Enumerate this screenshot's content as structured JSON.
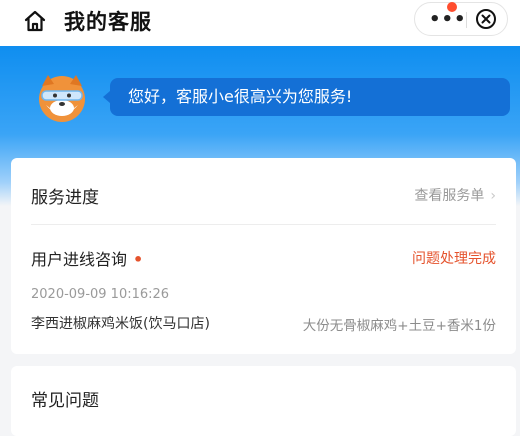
{
  "nav": {
    "title": "我的客服",
    "more_glyph": "•••"
  },
  "banner": {
    "greeting": "您好，客服小e很高兴为您服务!"
  },
  "service_progress": {
    "title": "服务进度",
    "view_link": "查看服务单",
    "chevron": "›",
    "consult_label": "用户进线咨询",
    "dot": "•",
    "status": "问题处理完成",
    "timestamp": "2020-09-09 10:16:26",
    "shop": "李西进椒麻鸡米饭(饮马口店)",
    "order_items": "大份无骨椒麻鸡+土豆+香米1份"
  },
  "faq": {
    "title": "常见问题"
  },
  "colors": {
    "brand_blue": "#0f8ef0",
    "bubble_blue": "#1470d6",
    "status_red": "#e5532d",
    "notification_dot": "#ff4d2e"
  }
}
